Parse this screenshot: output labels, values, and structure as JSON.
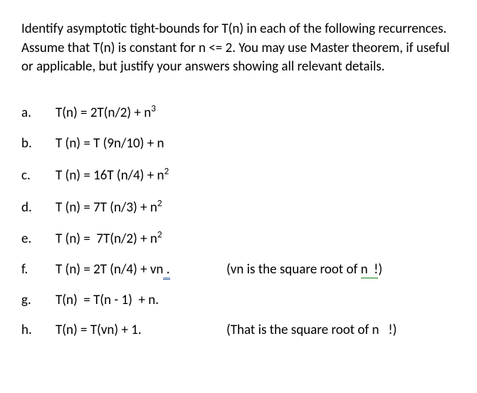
{
  "intro": "Identify asymptotic tight-bounds for T(n) in each of the following recurrences. Assume that T(n) is constant for n <= 2. You may use Master theorem, if useful or applicable, but justify your answers showing all relevant details.",
  "items": [
    {
      "letter": "a.",
      "eq_html": "T(n) = 2T(n/2) + n<sup>3</sup>",
      "note": ""
    },
    {
      "letter": "b.",
      "eq_html": "T (n) = T (9n/10) + n",
      "note": ""
    },
    {
      "letter": "c.",
      "eq_html": "T (n) = 16T (n/4) + n<sup>2</sup>",
      "note": ""
    },
    {
      "letter": "d.",
      "eq_html": "T (n) = 7T (n/3) + n<sup>2</sup>",
      "note": ""
    },
    {
      "letter": "e.",
      "eq_html": "T (n) = <span class=\"undblue\">&nbsp;7T</span>(n/2) + n<sup>2</sup>",
      "note": ""
    },
    {
      "letter": "f.",
      "eq_html": "T (n) = 2T (n/4) + <span class=\"undred\">vn</span><span class=\"dblunder\">&nbsp;.</span>",
      "note_html": "(<span class=\"undred\">vn</span> is the square root of <span class=\"undgreen\">n&nbsp;&nbsp;!</span>)"
    },
    {
      "letter": "g.",
      "eq_html": "T(n)&nbsp; = T(n - 1)&nbsp; + n.",
      "note": ""
    },
    {
      "letter": "h.",
      "eq_html": "T(n) = T(<span class=\"undred\">vn</span>) + 1.",
      "note_html": "(That is the square root of n&nbsp;&nbsp; !)"
    }
  ]
}
